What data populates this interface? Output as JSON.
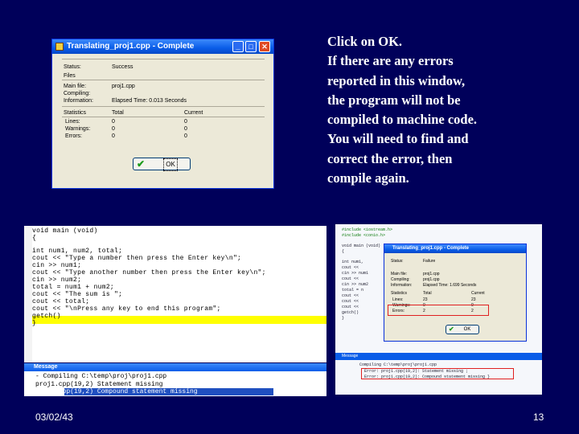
{
  "slide": {
    "instructions": [
      "Click on OK.",
      "If there are any errors",
      "reported in this window,",
      "the program will not be",
      "compiled to machine code.",
      "You will need to find and",
      "correct the error, then",
      "compile again."
    ],
    "date": "03/02/43",
    "page_number": "13"
  },
  "dialog": {
    "title": "Translating_proj1.cpp - Complete",
    "buttons": [
      "_",
      "□",
      "✕"
    ],
    "status_label": "Status:",
    "status_value": "Success",
    "files_label": "Files",
    "main_file_label": "Main file:",
    "main_file_value": "proj1.cpp",
    "compiling_label": "Compiling:",
    "information_label": "Information:",
    "information_value": "Elapsed Time: 0.013 Seconds",
    "stats_headers": [
      "Statistics",
      "Total",
      "Current"
    ],
    "stats_rows": [
      {
        "label": "Lines:",
        "total": "0",
        "current": "0"
      },
      {
        "label": "Warnings:",
        "total": "0",
        "current": "0"
      },
      {
        "label": "Errors:",
        "total": "0",
        "current": "0"
      }
    ],
    "ok_label": "OK"
  },
  "code": {
    "lines": [
      "void main (void)",
      "{",
      "  int num1, num2, total;",
      "  cout << \"Type a number then press the Enter key\\n\";",
      "  cin >> num1;",
      "  cout << \"Type another number then press the Enter key\\n\";",
      "  cin >> num2;",
      "  total = num1 + num2;",
      "  cout << \"The sum is \";",
      "  cout << total;",
      "  cout << \"\\nPress any key to end this program\";",
      "  getch()",
      "}"
    ]
  },
  "messages": {
    "title": "Message",
    "lines": [
      "- Compiling C:\\temp\\proj\\proj1.cpp",
      "    proj1.cpp(19,2) Statement missing",
      "    proj1.cpp(19,2) Compound statement missing"
    ]
  },
  "right_dialog": {
    "title": "Translating_proj1.cpp - Complete",
    "status_label": "Status:",
    "status_value": "Failure",
    "main_file_label": "Main file:",
    "main_file_value": "proj1.cpp",
    "compiling_label": "Compiling:",
    "compiling_value": "proj1.cpp",
    "information_label": "Information:",
    "information_value": "Elapsed Time: 1.699 Seconds",
    "stats_headers": [
      "Statistics",
      "Total",
      "Current"
    ],
    "stats_rows": [
      {
        "label": "Lines:",
        "total": "23",
        "current": "23"
      },
      {
        "label": "Warnings:",
        "total": "0",
        "current": "0"
      },
      {
        "label": "Errors:",
        "total": "2",
        "current": "2"
      }
    ],
    "ok_label": "OK",
    "message_title": "Message",
    "code_lines": [
      "#include <iostream.h>",
      "#include <conio.h>",
      "",
      "void main (void)",
      "{",
      "  int num1,",
      "  cout <<",
      "  cin >> num1",
      "  cout <<",
      "  cin >> num2",
      "  total = n",
      "  cout << ",
      "  cout << ",
      "  cout << ",
      "  getch()",
      "}"
    ],
    "message_lines": [
      "Compiling C:\\temp\\proj\\proj1.cpp",
      "Error: proj1.cpp(19,2): Statement missing ;",
      "Error: proj1.cpp(19,2): Compound statement missing }"
    ]
  },
  "colors": {
    "slide_bg": "#00005a",
    "xp_title": "#0a5de8",
    "highlight_line": "#ffff00",
    "error_box": "#e02020",
    "check_icon": "#1a9a1a"
  }
}
